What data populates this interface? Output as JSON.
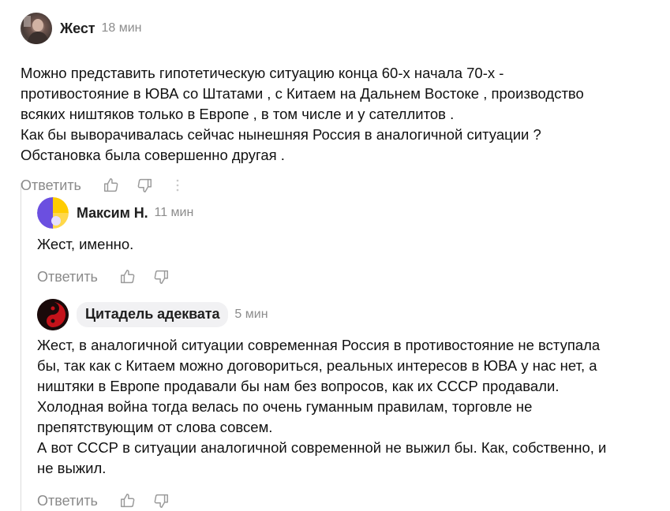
{
  "comments": [
    {
      "author": "Жест",
      "time": "18 мин",
      "text": "Можно представить гипотетическую ситуацию конца 60-х начала 70-х -\nпротивостояние в ЮВА со Штатами , с Китаем на Дальнем Востоке , производство\nвсяких ништяков только в Европе , в том числе и у сателлитов .\nКак бы выворачивалась сейчас нынешняя Россия в аналогичной ситуации ?\nОбстановка была совершенно другая .",
      "reply_label": "Ответить",
      "avatar_icon": "user-photo-avatar"
    },
    {
      "author": "Максим Н.",
      "time": "11 мин",
      "text": "Жест, именно.",
      "reply_label": "Ответить",
      "avatar_icon": "geometric-avatar"
    },
    {
      "author": "Цитадель адеквата",
      "time": "5 мин",
      "text": "Жест, в аналогичной ситуации современная Россия в противостояние не вступала\nбы, так как с Китаем можно договориться, реальных интересов в ЮВА у нас нет, а\nништяки в Европе продавали бы нам без вопросов, как их СССР продавали.\nХолодная война тогда велась по очень гуманным правилам, торговле не\nпрепятствующим от слова совсем.\nА вот СССР в ситуации аналогичной современной не выжил бы. Как, собственно, и\nне выжил.",
      "reply_label": "Ответить",
      "avatar_icon": "yin-yang-avatar"
    }
  ],
  "colors": {
    "meta_gray": "#8c8c8c",
    "reply_gray": "#8a8a8a",
    "icon_gray": "#9a9a9a",
    "pill_bg": "#f1f1f3",
    "thread_line": "#dcdcdc",
    "avatar_yellow": "#ffcc00",
    "avatar_purple": "#6b4fe0",
    "avatar_red": "#c4121a"
  }
}
